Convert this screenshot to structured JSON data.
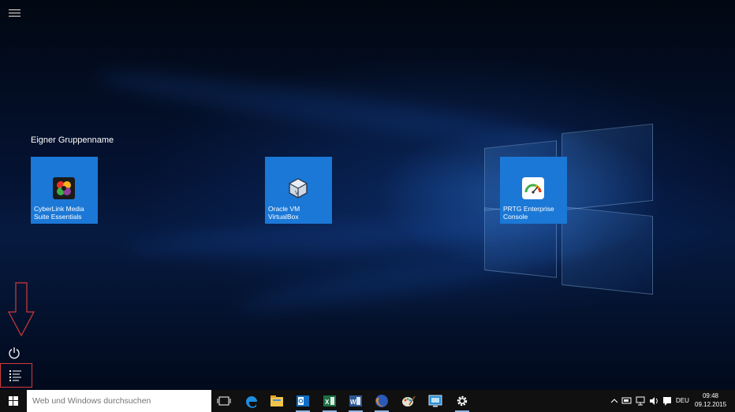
{
  "start_menu": {
    "group_title": "Eigner Gruppenname",
    "tiles": [
      {
        "label": "CyberLink Media\nSuite Essentials",
        "icon": "cyberlink-icon"
      },
      {
        "label": "Oracle VM\nVirtualBox",
        "icon": "virtualbox-icon"
      },
      {
        "label": "PRTG Enterprise\nConsole",
        "icon": "prtg-icon"
      }
    ],
    "tile_color": "#1b78d6"
  },
  "taskbar": {
    "search_placeholder": "Web und Windows durchsuchen",
    "pinned": [
      "task-view-icon",
      "edge-icon",
      "file-explorer-icon",
      "outlook-icon",
      "excel-icon",
      "word-icon",
      "firefox-icon",
      "paint-icon",
      "remote-desktop-icon",
      "settings-icon"
    ],
    "tray": {
      "language": "DEU",
      "time": "09:48",
      "date": "09.12.2015"
    }
  },
  "annotation_color": "#d23b3b"
}
